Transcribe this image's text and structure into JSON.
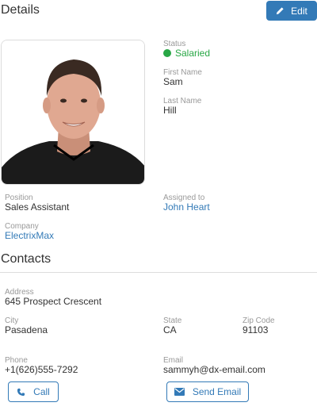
{
  "header": {
    "title": "Details",
    "edit_label": "Edit"
  },
  "employee": {
    "status_label": "Status",
    "status": "Salaried",
    "status_color": "#28a745",
    "first_name_label": "First Name",
    "first_name": "Sam",
    "last_name_label": "Last Name",
    "last_name": "Hill",
    "position_label": "Position",
    "position": "Sales Assistant",
    "assigned_label": "Assigned to",
    "assigned_to": "John Heart",
    "company_label": "Company",
    "company": "ElectrixMax"
  },
  "contacts": {
    "title": "Contacts",
    "address_label": "Address",
    "address": "645 Prospect Crescent",
    "city_label": "City",
    "city": "Pasadena",
    "state_label": "State",
    "state": "CA",
    "zip_label": "Zip Code",
    "zip": "91103",
    "phone_label": "Phone",
    "phone": "+1(626)555-7292",
    "email_label": "Email",
    "email": "sammyh@dx-email.com",
    "call_label": "Call",
    "send_email_label": "Send Email"
  },
  "colors": {
    "accent": "#337ab7",
    "label": "#999999",
    "text": "#333333"
  },
  "icons": {
    "edit": "pencil-icon",
    "call": "phone-icon",
    "email": "envelope-icon",
    "status": "status-dot-icon"
  }
}
